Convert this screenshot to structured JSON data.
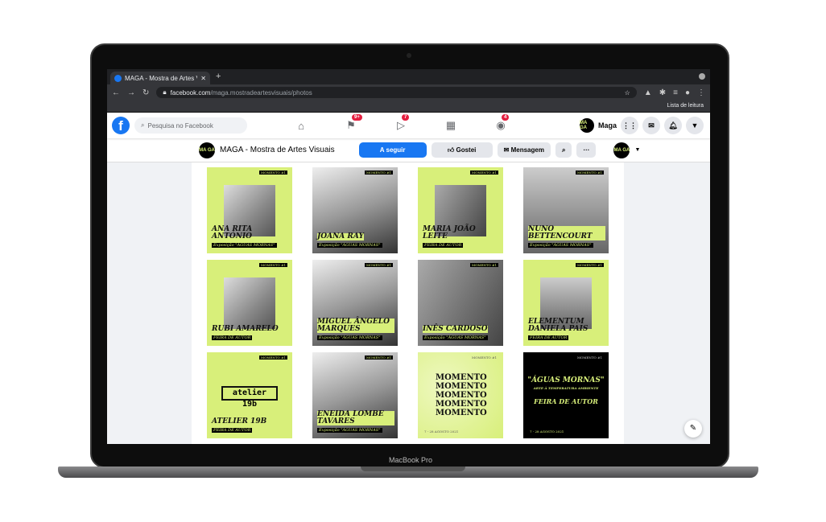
{
  "device": {
    "label": "MacBook Pro"
  },
  "browser": {
    "tab_title": "MAGA - Mostra de Artes Visuais",
    "url_host": "facebook.com",
    "url_path": "/maga.mostradeartesvisuais/photos",
    "reading_list": "Lista de leitura"
  },
  "fb": {
    "search_placeholder": "Pesquisa no Facebook",
    "badges": {
      "pages": "9+",
      "watch": "7",
      "groups": "4"
    },
    "profile_name": "Maga",
    "avatar_text": "MA GA"
  },
  "page": {
    "title": "MAGA - Mostra de Artes Visuais",
    "following": "A seguir",
    "liked": "Gostei",
    "message": "Mensagem"
  },
  "accent": "#d8ef7a",
  "tiles": [
    {
      "kind": "green",
      "photo": "inset",
      "name": "ANA RITA ANTÓNIO",
      "sub": "Exposição \"ÁGUAS MORNAS\"",
      "mom": "MOMENTO #1"
    },
    {
      "kind": "photo",
      "name": "JOANA RAY",
      "sub": "Exposição \"ÁGUAS MORNAS\"",
      "mom": "MOMENTO #1"
    },
    {
      "kind": "green",
      "photo": "inset",
      "name": "MARIA JOÃO LEITE",
      "sub": "FEIRA DE AUTOR",
      "mom": "MOMENTO #1"
    },
    {
      "kind": "photo",
      "name": "NUNO BETTENCOURT",
      "sub": "Exposição \"ÁGUAS MORNAS\"",
      "mom": "MOMENTO #1"
    },
    {
      "kind": "green",
      "photo": "inset",
      "name": "RUBI AMARELO",
      "sub": "FEIRA DE AUTOR",
      "mom": "MOMENTO #1"
    },
    {
      "kind": "photo",
      "name": "MIGUEL ÂNGELO MARQUES",
      "sub": "Exposição \"ÁGUAS MORNAS\"",
      "mom": "MOMENTO #1"
    },
    {
      "kind": "photo",
      "name": "INÊS CARDOSO",
      "sub": "Exposição \"ÁGUAS MORNAS\"",
      "mom": "MOMENTO #1"
    },
    {
      "kind": "green",
      "photo": "inset",
      "name": "ELEMENTUM DANIELA PAIS",
      "sub": "FEIRA DE AUTOR",
      "mom": "MOMENTO #1"
    },
    {
      "kind": "green",
      "photo": "logo",
      "logo": "atelier 19b",
      "name": "ATELIER 19B",
      "sub": "FEIRA DE AUTOR",
      "mom": "MOMENTO #1"
    },
    {
      "kind": "photo",
      "name": "ENEIDA LOMBE TAVARES",
      "sub": "Exposição \"ÁGUAS MORNAS\"",
      "mom": "MOMENTO #1"
    },
    {
      "kind": "momento",
      "big": "MOMENTO MOMENTO MOMENTO MOMENTO MOMENTO",
      "date": "7 - 28 AGOSTO 2021",
      "mom": "MOMENTO #1"
    },
    {
      "kind": "black",
      "big": "\"ÁGUAS MORNAS\"",
      "line2": "ARTE À TEMPERATURA AMBIENTE",
      "line3": "FEIRA DE AUTOR",
      "date": "7 - 28 AGOSTO 2021",
      "mom": "MOMENTO #1"
    }
  ]
}
